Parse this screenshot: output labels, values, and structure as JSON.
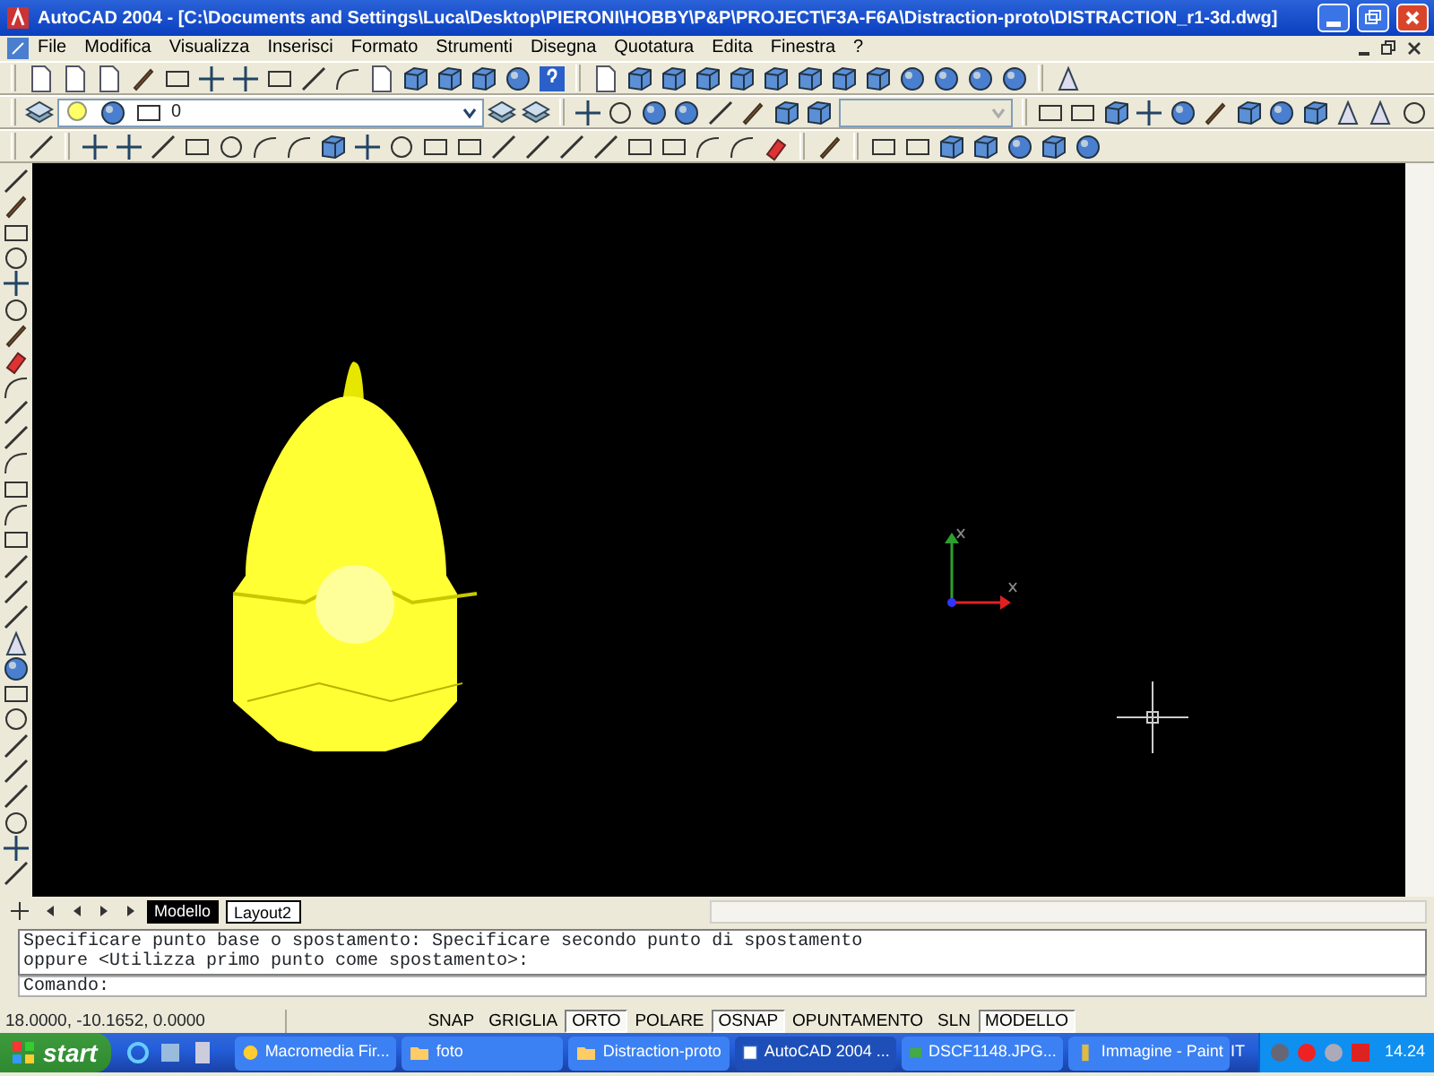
{
  "window": {
    "title": "AutoCAD 2004 - [C:\\Documents and Settings\\Luca\\Desktop\\PIERONI\\HOBBY\\P&P\\PROJECT\\F3A-F6A\\Distraction-proto\\DISTRACTION_r1-3d.dwg]"
  },
  "menu": [
    "File",
    "Modifica",
    "Visualizza",
    "Inserisci",
    "Formato",
    "Strumenti",
    "Disegna",
    "Quotatura",
    "Edita",
    "Finestra",
    "?"
  ],
  "layer_combo": {
    "value": "0"
  },
  "layout_tabs": [
    {
      "label": "Modello",
      "selected": true
    },
    {
      "label": "Layout2",
      "selected": false
    }
  ],
  "command_window": {
    "history": [
      "Specificare punto base o spostamento: Specificare secondo punto di spostamento",
      "oppure <Utilizza primo punto come spostamento>:"
    ],
    "prompt": "Comando:"
  },
  "status_bar": {
    "coordinates": "18.0000, -10.1652, 0.0000",
    "toggles": [
      {
        "label": "SNAP",
        "on": false
      },
      {
        "label": "GRIGLIA",
        "on": false
      },
      {
        "label": "ORTO",
        "on": true
      },
      {
        "label": "POLARE",
        "on": false
      },
      {
        "label": "OSNAP",
        "on": true
      },
      {
        "label": "OPUNTAMENTO",
        "on": false
      },
      {
        "label": "SLN",
        "on": false
      },
      {
        "label": "MODELLO",
        "on": true
      }
    ]
  },
  "taskbar": {
    "start": "start",
    "tasks": [
      {
        "label": "Macromedia Fir...",
        "kind": "app",
        "selected": false
      },
      {
        "label": "foto",
        "kind": "folder",
        "selected": false
      },
      {
        "label": "Distraction-proto",
        "kind": "folder",
        "selected": false
      },
      {
        "label": "AutoCAD 2004 ...",
        "kind": "cad",
        "selected": true
      },
      {
        "label": "DSCF1148.JPG...",
        "kind": "image",
        "selected": false
      },
      {
        "label": "Immagine - Paint",
        "kind": "paint",
        "selected": false
      }
    ],
    "language": "IT",
    "clock": "14.24"
  }
}
